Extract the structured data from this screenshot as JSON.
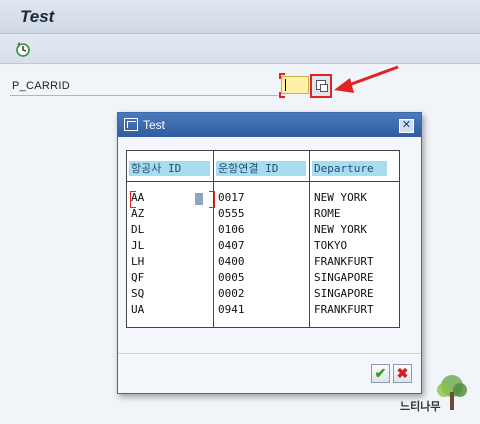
{
  "window": {
    "title": "Test"
  },
  "toolbar": {
    "execute_icon": "execute-clock-icon"
  },
  "selection_screen": {
    "field_label": "P_CARRID",
    "field_value": "",
    "help_icon": "f4-value-help-icon"
  },
  "dialog": {
    "title": "Test",
    "close_glyph": "✕",
    "columns": [
      "항공사 ID",
      "운항연결 ID",
      "Departure"
    ],
    "rows": [
      [
        "AA",
        "0017",
        "NEW YORK"
      ],
      [
        "AZ",
        "0555",
        "ROME"
      ],
      [
        "DL",
        "0106",
        "NEW YORK"
      ],
      [
        "JL",
        "0407",
        "TOKYO"
      ],
      [
        "LH",
        "0400",
        "FRANKFURT"
      ],
      [
        "QF",
        "0005",
        "SINGAPORE"
      ],
      [
        "SQ",
        "0002",
        "SINGAPORE"
      ],
      [
        "UA",
        "0941",
        "FRANKFURT"
      ]
    ],
    "ok_glyph": "✔",
    "cancel_glyph": "✖"
  },
  "watermark": {
    "text": "느티나무"
  },
  "colors": {
    "accent": "#2f5d9f",
    "header_bg": "#a9dcef",
    "highlight": "#e02424",
    "input_bg": "#fff2a8"
  }
}
